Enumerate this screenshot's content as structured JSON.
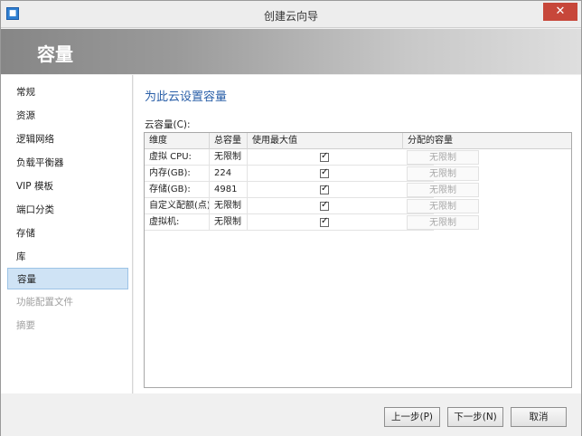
{
  "window": {
    "title": "创建云向导",
    "icon_name": "app-icon",
    "close_glyph": "✕"
  },
  "header": {
    "title": "容量"
  },
  "sidebar": {
    "items": [
      {
        "label": "常规",
        "state": "normal"
      },
      {
        "label": "资源",
        "state": "normal"
      },
      {
        "label": "逻辑网络",
        "state": "normal"
      },
      {
        "label": "负载平衡器",
        "state": "normal"
      },
      {
        "label": "VIP 模板",
        "state": "normal"
      },
      {
        "label": "端口分类",
        "state": "normal"
      },
      {
        "label": "存储",
        "state": "normal"
      },
      {
        "label": "库",
        "state": "normal"
      },
      {
        "label": "容量",
        "state": "active"
      },
      {
        "label": "功能配置文件",
        "state": "disabled"
      },
      {
        "label": "摘要",
        "state": "disabled"
      }
    ]
  },
  "main": {
    "heading": "为此云设置容量",
    "grid_label": "云容量(C):",
    "columns": [
      "维度",
      "总容量",
      "使用最大值",
      "分配的容量"
    ],
    "rows": [
      {
        "dimension": "虚拟 CPU:",
        "total": "无限制",
        "use_max": true,
        "allocated": "无限制"
      },
      {
        "dimension": "内存(GB):",
        "total": "224",
        "use_max": true,
        "allocated": "无限制"
      },
      {
        "dimension": "存储(GB):",
        "total": "4981",
        "use_max": true,
        "allocated": "无限制"
      },
      {
        "dimension": "自定义配额(点):",
        "total": "无限制",
        "use_max": true,
        "allocated": "无限制"
      },
      {
        "dimension": "虚拟机:",
        "total": "无限制",
        "use_max": true,
        "allocated": "无限制"
      }
    ]
  },
  "footer": {
    "prev_label": "上一步(P)",
    "next_label": "下一步(N)",
    "cancel_label": "取消"
  }
}
